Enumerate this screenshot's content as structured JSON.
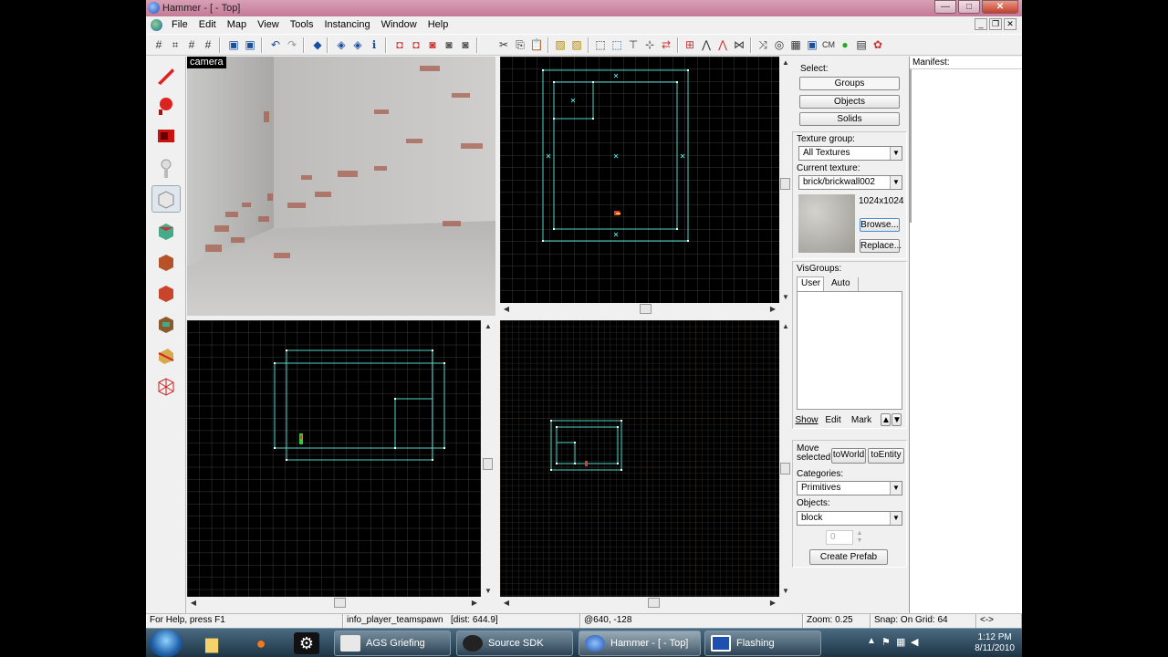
{
  "window": {
    "title": "Hammer - [ - Top]",
    "min": "—",
    "max": "□",
    "close": "✕"
  },
  "menu": [
    "File",
    "Edit",
    "Map",
    "View",
    "Tools",
    "Instancing",
    "Window",
    "Help"
  ],
  "toolbar": {
    "cm_label": "CM"
  },
  "viewports": {
    "camera_label": "camera"
  },
  "select": {
    "title": "Select:",
    "buttons": [
      "Groups",
      "Objects",
      "Solids"
    ]
  },
  "texture": {
    "group_label": "Texture group:",
    "group_value": "All Textures",
    "current_label": "Current texture:",
    "current_value": "brick/brickwall002",
    "size": "1024x1024",
    "browse": "Browse...",
    "replace": "Replace..."
  },
  "visgroups": {
    "title": "VisGroups:",
    "tabs": [
      "User",
      "Auto"
    ],
    "buttons": [
      "Show",
      "Edit",
      "Mark"
    ],
    "up": "🡡",
    "down": "🡣"
  },
  "move": {
    "label": "Move selected:",
    "to_world": "toWorld",
    "to_entity": "toEntity"
  },
  "objects": {
    "categories_label": "Categories:",
    "categories_value": "Primitives",
    "objects_label": "Objects:",
    "objects_value": "block",
    "count": "0",
    "create": "Create Prefab"
  },
  "manifest": {
    "title": "Manifest:"
  },
  "status": {
    "help": "For Help, press F1",
    "entity": "info_player_teamspawn",
    "dist": "[dist: 644.9]",
    "coords": "@640, -128",
    "zoom": "Zoom: 0.25",
    "snap": "Snap: On Grid: 64",
    "arrows": "<->"
  },
  "taskbar": {
    "items": [
      "AGS Griefing",
      "Source SDK",
      "Hammer - [ - Top]",
      "Flashing"
    ],
    "time": "1:12 PM",
    "date": "8/11/2010"
  },
  "colors": {
    "grid_line": "#3a3a3a",
    "brush": "#4fd6c8",
    "handle": "#ffffff"
  }
}
